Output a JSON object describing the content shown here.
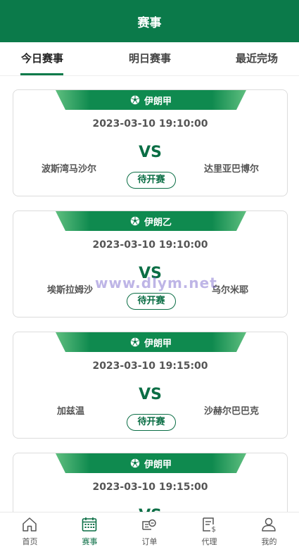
{
  "header": {
    "title": "赛事"
  },
  "tabs": [
    {
      "label": "今日赛事",
      "active": true
    },
    {
      "label": "明日赛事",
      "active": false
    },
    {
      "label": "最近完场",
      "active": false
    }
  ],
  "matches": [
    {
      "league": "伊朗甲",
      "time": "2023-03-10 19:10:00",
      "vs": "VS",
      "home": "波斯湾马沙尔",
      "away": "达里亚巴博尔",
      "status": "待开赛"
    },
    {
      "league": "伊朗乙",
      "time": "2023-03-10 19:10:00",
      "vs": "VS",
      "home": "埃斯拉姆沙",
      "away": "乌尔米耶",
      "status": "待开赛"
    },
    {
      "league": "伊朗甲",
      "time": "2023-03-10 19:15:00",
      "vs": "VS",
      "home": "加兹温",
      "away": "沙赫尔巴巴克",
      "status": "待开赛"
    },
    {
      "league": "伊朗甲",
      "time": "2023-03-10 19:15:00",
      "vs": "VS",
      "home": "",
      "away": "",
      "status": ""
    }
  ],
  "watermark": "www.dlym.net",
  "bottom_nav": [
    {
      "label": "首页",
      "icon": "home-icon",
      "active": false
    },
    {
      "label": "赛事",
      "icon": "calendar-icon",
      "active": true
    },
    {
      "label": "订单",
      "icon": "order-icon",
      "active": false
    },
    {
      "label": "代理",
      "icon": "agent-bill-icon",
      "active": false
    },
    {
      "label": "我的",
      "icon": "user-icon",
      "active": false
    }
  ],
  "colors": {
    "brand": "#0b7a4a",
    "accent": "#0b6e45"
  }
}
